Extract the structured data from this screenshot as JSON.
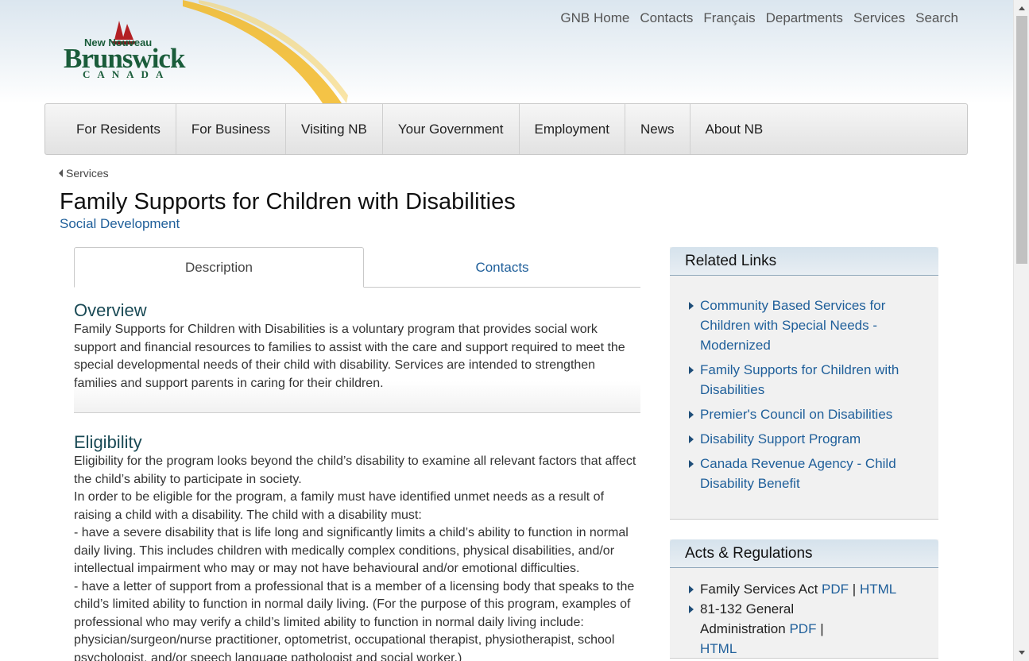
{
  "logo": {
    "line1": "New Nouveau",
    "line2": "Brunswick",
    "line3": "CANADA"
  },
  "top_nav": [
    "GNB Home",
    "Contacts",
    "Français",
    "Departments",
    "Services",
    "Search"
  ],
  "main_nav": [
    "For Residents",
    "For Business",
    "Visiting NB",
    "Your Government",
    "Employment",
    "News",
    "About NB"
  ],
  "breadcrumb": "Services",
  "page": {
    "title": "Family Supports for Children with Disabilities",
    "department": "Social Development"
  },
  "tabs": {
    "description": "Description",
    "contacts": "Contacts"
  },
  "overview": {
    "heading": "Overview",
    "text": "Family Supports for Children with Disabilities is a voluntary program that provides social work support and financial resources to families to assist with the care and support required to meet the special developmental needs of their child with disability. Services are intended to strengthen families and support parents in caring for their children."
  },
  "eligibility": {
    "heading": "Eligibility",
    "p1": "Eligibility for the program looks beyond the child’s disability to examine all relevant factors that affect the child’s ability to participate in society.",
    "p2": "In order to be eligible for the program, a family must have identified unmet needs as a result of raising a child with a disability. The child with a disability must:",
    "p3": "- have a severe disability that is life long and significantly limits a child’s ability to function in normal daily living. This includes children with medically complex conditions, physical disabilities, and/or intellectual impairment who may or may not have behavioural and/or emotional difficulties.",
    "p4": "- have a letter of support from a professional that is a member of a licensing body that speaks to the child’s limited ability to function in normal daily living. (For the purpose of this program, examples of professional who may verify a child’s limited ability to function in normal daily living include: physician/surgeon/nurse practitioner, optometrist, occupational therapist, physiotherapist, school psychologist, and/or speech language pathologist and social worker.)"
  },
  "related_links": {
    "heading": "Related Links",
    "items": [
      "Community Based Services for Children with Special Needs - Modernized",
      "Family Supports for Children with Disabilities",
      "Premier's Council on Disabilities",
      "Disability Support Program",
      "Canada Revenue Agency - Child Disability Benefit"
    ]
  },
  "acts": {
    "heading": "Acts & Regulations",
    "items": [
      {
        "name": "Family Services Act",
        "pdf": "PDF",
        "sep": "|",
        "html": "HTML"
      },
      {
        "name": "81-132 General Administration",
        "pdf": "PDF",
        "sep": "|",
        "html": "HTML"
      }
    ]
  }
}
